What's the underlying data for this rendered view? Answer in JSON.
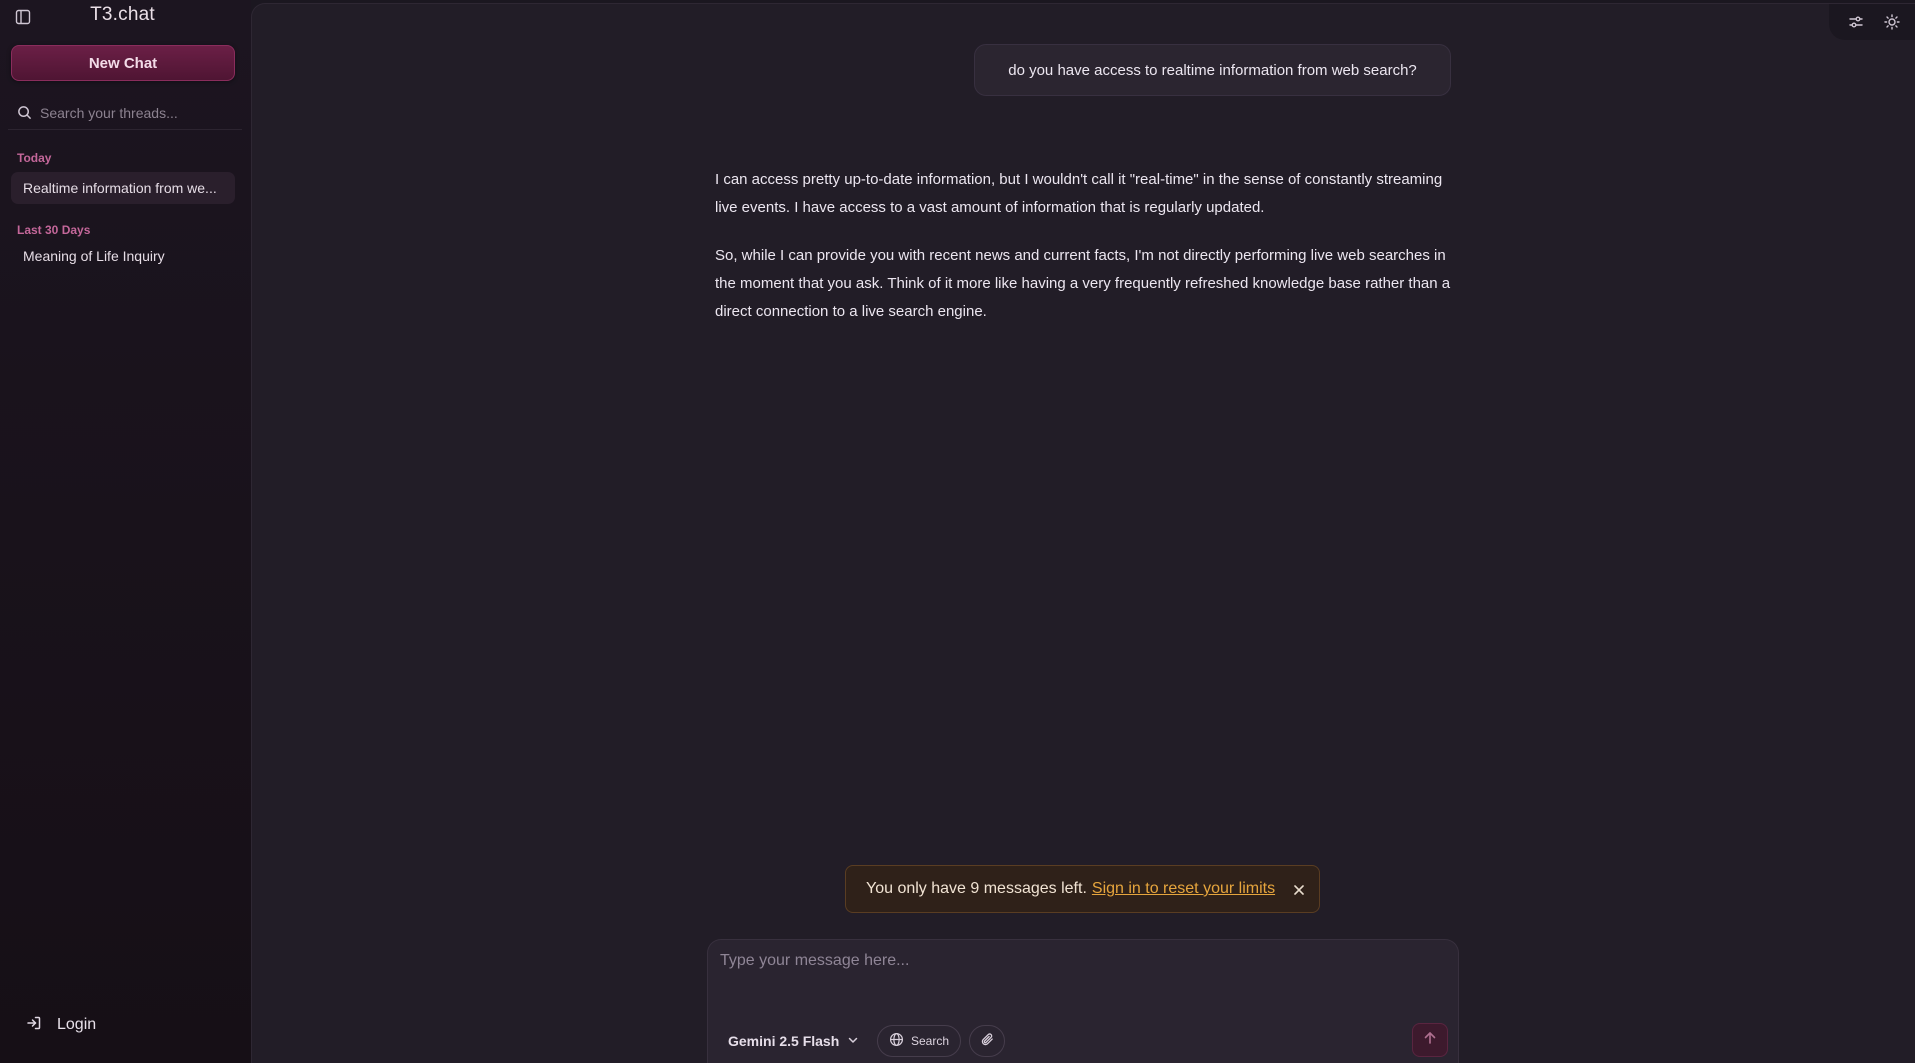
{
  "sidebar": {
    "brand": "T3.chat",
    "new_chat_label": "New Chat",
    "search_placeholder": "Search your threads...",
    "groups": [
      {
        "label": "Today",
        "threads": [
          "Realtime information from we..."
        ]
      },
      {
        "label": "Last 30 Days",
        "threads": [
          "Meaning of Life Inquiry"
        ]
      }
    ],
    "login_label": "Login"
  },
  "chat": {
    "user_message": "do you have access to realtime information from web search?",
    "assistant_paragraphs": [
      "I can access pretty up-to-date information, but I wouldn't call it \"real-time\" in the sense of constantly streaming live events. I have access to a vast amount of information that is regularly updated.",
      "So, while I can provide you with recent news and current facts, I'm not directly performing live web searches in the moment that you ask. Think of it more like having a very frequently refreshed knowledge base rather than a direct connection to a live search engine."
    ]
  },
  "toast": {
    "message": "You only have 9 messages left.",
    "link": "Sign in to reset your limits"
  },
  "composer": {
    "placeholder": "Type your message here...",
    "model": "Gemini 2.5 Flash",
    "search_label": "Search"
  },
  "icons": [
    "sidebar-toggle-icon",
    "search-icon",
    "login-icon",
    "settings-sliders-icon",
    "sun-icon",
    "close-icon",
    "chevron-down-icon",
    "globe-icon",
    "paperclip-icon",
    "arrow-up-icon"
  ],
  "colors": {
    "accent": "#6b1f46",
    "group_label": "#c4679a",
    "toast_link": "#e6a53d",
    "main_bg": "#221d27",
    "sidebar_bg": "#1c1520"
  }
}
